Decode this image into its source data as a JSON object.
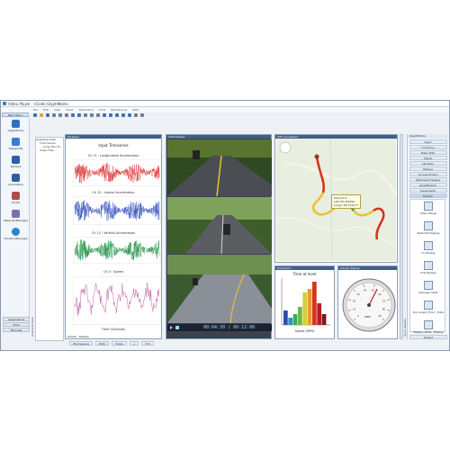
{
  "window": {
    "title": "Video Player - nCode GlyphWorks",
    "controls": [
      "–",
      "□",
      "×"
    ]
  },
  "menu": {
    "main_menu_label": "Main Menu",
    "items": [
      "File",
      "Edit",
      "View",
      "Insert",
      "Interactive",
      "Tools",
      "Workspaces",
      "Help"
    ]
  },
  "toolbar": {
    "buttons": [
      "new-icon",
      "open-icon",
      "save-icon",
      "cut-icon",
      "copy-icon",
      "paste-icon",
      "undo-icon",
      "redo-icon",
      "zoom-icon",
      "run-icon",
      "stop-icon",
      "record-icon",
      "play-icon",
      "pause-icon",
      "rewind-icon",
      "forward-icon",
      "settings-icon",
      "help-icon"
    ]
  },
  "leftnav": {
    "items": [
      {
        "label": "GlyphWorks",
        "icon": "glyphworks-icon",
        "color": "#2f6fc2"
      },
      {
        "label": "DesignLife",
        "icon": "designlife-icon",
        "color": "#3a7bd0"
      },
      {
        "label": "Worklys",
        "icon": "worklys-icon",
        "color": "#2b5fa8"
      },
      {
        "label": "Automation",
        "icon": "automation-icon",
        "color": "#2d5ea5"
      },
      {
        "label": "Studio",
        "icon": "studio-icon",
        "color": "#b34a4a"
      },
      {
        "label": "MaterialsManager",
        "icon": "materials-icon",
        "color": "#7a6fb3"
      },
      {
        "label": "VibrationManager",
        "icon": "vibration-icon",
        "color": "#2f84c8"
      }
    ],
    "bottom": [
      "Applications",
      "Tools",
      "Manuals"
    ],
    "side_label": "Available Data"
  },
  "tree": {
    "rows": [
      "Available Data",
      "Time Series",
      "Long TS1 Ch..",
      "Video Files"
    ]
  },
  "timeseries": {
    "header": "Display1",
    "title": "Input Timeseries",
    "channels": [
      {
        "label": "Ch 11 : Longitudinal Acceleration",
        "color": "#d62020"
      },
      {
        "label": "Ch 12 : Lateral Acceleration",
        "color": "#1f3fb5"
      },
      {
        "label": "Ch 13 : Vertical Acceleration",
        "color": "#11893b"
      },
      {
        "label": "Ch 4 : Speed",
        "color": "#c05aa8"
      }
    ],
    "xlabel": "Time (Seconds)",
    "tabs": [
      "Charts",
      "Display"
    ]
  },
  "video": {
    "header": "Video Player",
    "timecode": "00:04:30 / 00:12:00"
  },
  "map": {
    "header": "GPS and Speed",
    "callout": [
      "Point ID:1",
      "Lat=35.432591",
      "Long=-83.722277"
    ]
  },
  "histogram": {
    "header": "Histogram",
    "title": "Time at level",
    "xlabel": "Speed (MPH)",
    "values": [
      4,
      2,
      3,
      5,
      9,
      10,
      12,
      6,
      3
    ]
  },
  "gauge": {
    "header": "Gauge Display",
    "unit": "MPH",
    "ticks": [
      "0",
      "10",
      "20",
      "30",
      "40",
      "50",
      "60",
      "70",
      "80",
      "90"
    ],
    "value": 54
  },
  "rightpanel": {
    "header": "GlyphWorks",
    "items": [
      "Input",
      "Functions",
      "Basic DSP",
      "Signal",
      "Vibration",
      "Fatigue",
      "Accelerometry",
      "Optimised Fatigue",
      "GlyphBuilder",
      "SuperGlyph",
      "Display"
    ],
    "selected": "Display",
    "display_items": [
      "Video Player",
      "Waterfall Display",
      "XY Display",
      "XYZ Display",
      "Damage Stats",
      "Document_From_ Data",
      "Fatigue_Stats_ Display"
    ],
    "bottom": "Output",
    "side_label": "Glyph Palette"
  },
  "bottomtabs": {
    "items": [
      "Workspaces",
      "Data",
      "Views",
      "+",
      "Ctrl"
    ]
  }
}
